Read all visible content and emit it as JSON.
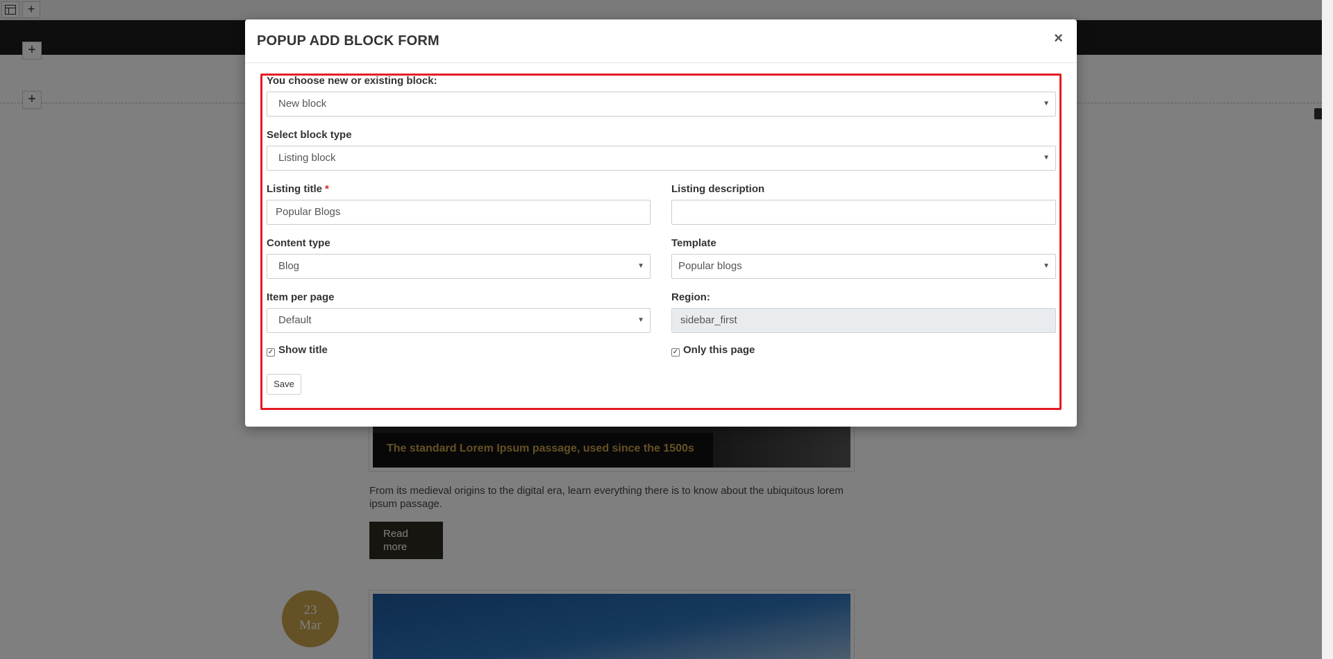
{
  "toolbar": {
    "layout_icon": "layout-grid-icon",
    "add_label": "+"
  },
  "builder": {
    "add_label": "+"
  },
  "blog": {
    "post1_title": "The standard Lorem Ipsum passage, used since the 1500s",
    "post1_excerpt": "From its medieval origins to the digital era, learn everything there is to know about the ubiquitous lorem ipsum passage.",
    "read_more": "Read more",
    "date_day": "23",
    "date_month": "Mar"
  },
  "modal": {
    "title": "POPUP ADD BLOCK FORM",
    "close_label": "×",
    "fields": {
      "choose_block": {
        "label": "You choose new or existing block:",
        "value": "New block"
      },
      "block_type": {
        "label": "Select block type",
        "value": "Listing block"
      },
      "listing_title": {
        "label": "Listing title",
        "required_mark": "*",
        "value": "Popular Blogs"
      },
      "listing_description": {
        "label": "Listing description",
        "value": ""
      },
      "content_type": {
        "label": "Content type",
        "value": "Blog"
      },
      "template": {
        "label": "Template",
        "value": "Popular blogs"
      },
      "items_per_page": {
        "label": "Item per page",
        "value": "Default"
      },
      "region": {
        "label": "Region:",
        "value": "sidebar_first"
      }
    },
    "checkboxes": {
      "show_title": {
        "label": "Show title",
        "checked": true
      },
      "only_this_page": {
        "label": "Only this page",
        "checked": true
      }
    },
    "save_label": "Save",
    "caret": "▼",
    "check_mark": "✓"
  },
  "colors": {
    "highlight": "#e41b23",
    "accent_gold": "#c9a24b"
  }
}
